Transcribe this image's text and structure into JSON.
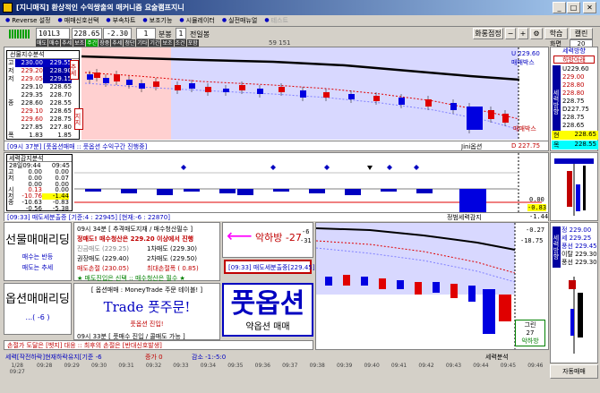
{
  "titlebar": {
    "title": "[지니매직] 환상적인 수익쌍출의 매커니즘 요술램프지니",
    "min": "_",
    "max": "□",
    "close": "✕"
  },
  "menu": [
    {
      "label": "Reverse 설정"
    },
    {
      "label": "매매신호선택"
    },
    {
      "label": "부속차트"
    },
    {
      "label": "보조기능"
    },
    {
      "label": "시뮬레이터"
    },
    {
      "label": "실전매뉴얼"
    },
    {
      "label": "테스트"
    }
  ],
  "toolbar": {
    "code": "101L3",
    "price": "228.65",
    "change": "-2.30",
    "period_value": "1",
    "period_unit": "분봉",
    "days_value": "1",
    "days_unit": "전일봉",
    "screen_settings": "화롱점정",
    "minus": "−",
    "plus": "+",
    "learn": "학습",
    "calendar": "캘린",
    "screen_label": "화면",
    "screen_value": "20",
    "sub_tabs": [
      "매도",
      "매수",
      "추세",
      "보조",
      "주간",
      "장중",
      "추세",
      "첨단",
      "기타",
      "기간",
      "보조",
      "조건",
      "포함"
    ],
    "index_label": "59 151"
  },
  "left_info": {
    "title": "선물지수분석",
    "rows": [
      {
        "label": "고",
        "a": "230.00",
        "b": "229.55"
      },
      {
        "label": "저",
        "a": "229.20",
        "b": "228.90"
      },
      {
        "label": "저",
        "a": "229.05",
        "b": "229.15"
      },
      {
        "label": "",
        "a": "229.10",
        "b": "228.65"
      },
      {
        "label": "",
        "a": "229.35",
        "b": "228.70"
      },
      {
        "label": "종",
        "a": "228.60",
        "b": "228.55"
      },
      {
        "label": "",
        "a": "229.10",
        "b": "228.65"
      },
      {
        "label": "",
        "a": "229.60",
        "b": "228.75"
      },
      {
        "label": "",
        "a": "227.85",
        "b": "227.80"
      },
      {
        "label": "폭",
        "a": "1.83",
        "b": "1.85"
      }
    ],
    "badge1": "추세",
    "badge2": "지지"
  },
  "main_chart": {
    "top_right_price": "U 229.60",
    "top_right_label": "매매박스",
    "bottom_right_label": "매매박스",
    "bottom_right_price": "D 227.75",
    "status_left": "[09시 37분] [풋옵션매매 :: 풋옵션 수익구간 진행중]",
    "status_right": "Jini옵션",
    "marks": [
      "매수",
      "매도"
    ]
  },
  "right_panel": {
    "title": "세력방향",
    "subtitle": "하방아래",
    "vertical_label": "세력방향",
    "values": [
      {
        "text": "U229.60",
        "color": "#000"
      },
      {
        "text": "229.00",
        "color": "#c00000"
      },
      {
        "text": "228.80",
        "color": "#c00000"
      },
      {
        "text": "228.80",
        "color": "#c00000"
      },
      {
        "text": "228.75",
        "color": "#000"
      },
      {
        "text": "D227.75",
        "color": "#000"
      },
      {
        "text": "228.75",
        "color": "#000"
      },
      {
        "text": "228.65",
        "color": "#000"
      }
    ],
    "current_label": "현",
    "current_value": "228.65",
    "target_label": "목",
    "target_value": "228.55",
    "mid_label": "세력방향",
    "mid_values": [
      "정 229.00",
      "세 229.25",
      "풍선 229.45",
      "이탈 229.30",
      "풍선 229.30"
    ]
  },
  "sub_chart": {
    "title": "세력감지분석",
    "time_label": "28일09:44",
    "time2": "09:45",
    "rows": [
      {
        "label": "고",
        "a": "0.00",
        "b": "0.00"
      },
      {
        "label": "저",
        "a": "0.00",
        "b": "0.07"
      },
      {
        "label": "",
        "a": "0.00",
        "b": "0.00"
      },
      {
        "label": "시",
        "a": "0.13",
        "b": "0.00"
      },
      {
        "label": "저",
        "a": "-10.76",
        "b": "-1.44"
      },
      {
        "label": "종",
        "a": "-10.63",
        "b": "-0.83"
      },
      {
        "label": "",
        "a": "-0.56",
        "b": "-5.38"
      }
    ],
    "right_vals": [
      "0.00",
      "-0.83",
      "-1.44"
    ],
    "status": "[09:33] 매도세분출증 [기준:4 : 22945] [현재:-6 : 22870]",
    "status_right": "정범세력감지"
  },
  "bottom_left": {
    "futures_title": "선물매매리딩",
    "futures_line1": "매수는 반등",
    "futures_line2": "매도는 추세",
    "options_title": "옵션매매리딩",
    "options_value": "...( -6 )"
  },
  "bottom_center": {
    "line1": "09시 34분 [ 추격매도지재 / 매수청산필수 ]",
    "line2": "정매도! 매수청산은 229.20 이상에서 진행",
    "line3a": "진금매도 (229.25)",
    "line3b": "1차매도 (229.30)",
    "line4a": "권장매도 (229.40)",
    "line4b": "2차매도 (229.50)",
    "line5a": "매도손절 (230.05)",
    "line5b": "최대손절폭 ( 0.85)",
    "line6": "★ 매도진입은 신택 :: 매수청산은 필수 ★",
    "option_line": "[ 옵션매매 : MoneyTrade 주문 테이블! ]",
    "trade_big": "Trade 풋주문!",
    "put_entry": "풋옵션 진입!",
    "put_time": "09시 33분 [ 풋매수 진입 / 콜매도 가능 ]",
    "footer": "손절가 도달은 [벳지] 대응 :: 최후의 손절은 [반대신호발생]"
  },
  "signal_box": {
    "arrow": "⟵",
    "label": "악하방 -27",
    "num1": "-6",
    "num2": "-31",
    "status": "[09:33] 매도세분출중[229.45]",
    "big_text": "풋옵션",
    "big_sub": "약옵션 매매"
  },
  "bottom_chart": {
    "right_vals": [
      "-0.27",
      "-18.75"
    ],
    "side_labels": [
      "그린",
      "27",
      "악하방"
    ]
  },
  "statusbar": {
    "left": "세력[작전하락]현재하락유지[기준 -6",
    "mid": "증가 0",
    "mid2": "감소 -1:-5:0",
    "right": "세력분석",
    "auto": "자동매매"
  },
  "timeline": [
    "1/28 09:27",
    "09:28",
    "09:29",
    "09:30",
    "09:31",
    "09:32",
    "09:33",
    "09:34",
    "09:35",
    "09:36",
    "09:37",
    "09:38",
    "09:39",
    "09:40",
    "09:41",
    "09:42",
    "09:43",
    "09:44",
    "09:45",
    "09:46"
  ],
  "colors": {
    "accent": "#0000c0",
    "up": "#e00000",
    "down": "#0000e0",
    "title": "#0a246a"
  }
}
